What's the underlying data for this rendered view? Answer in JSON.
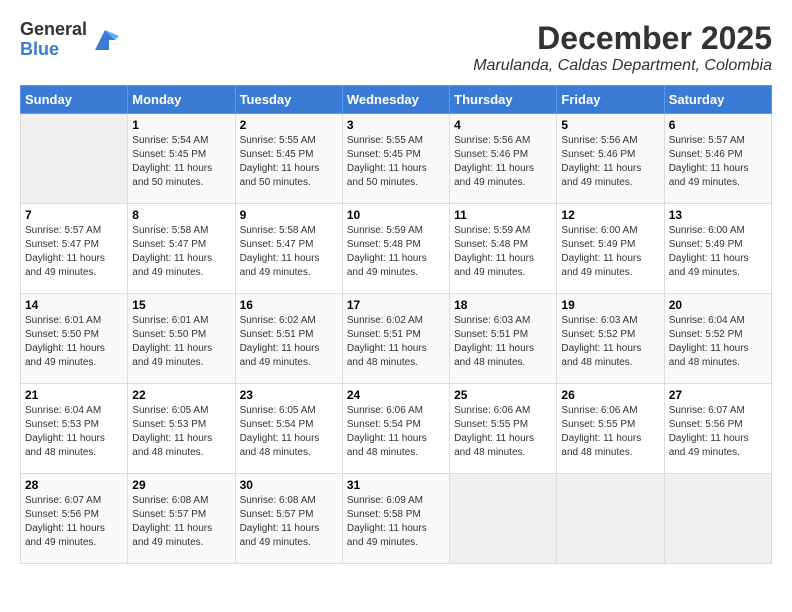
{
  "logo": {
    "general": "General",
    "blue": "Blue"
  },
  "title": "December 2025",
  "subtitle": "Marulanda, Caldas Department, Colombia",
  "days_of_week": [
    "Sunday",
    "Monday",
    "Tuesday",
    "Wednesday",
    "Thursday",
    "Friday",
    "Saturday"
  ],
  "weeks": [
    [
      {
        "day": "",
        "info": ""
      },
      {
        "day": "1",
        "info": "Sunrise: 5:54 AM\nSunset: 5:45 PM\nDaylight: 11 hours\nand 50 minutes."
      },
      {
        "day": "2",
        "info": "Sunrise: 5:55 AM\nSunset: 5:45 PM\nDaylight: 11 hours\nand 50 minutes."
      },
      {
        "day": "3",
        "info": "Sunrise: 5:55 AM\nSunset: 5:45 PM\nDaylight: 11 hours\nand 50 minutes."
      },
      {
        "day": "4",
        "info": "Sunrise: 5:56 AM\nSunset: 5:46 PM\nDaylight: 11 hours\nand 49 minutes."
      },
      {
        "day": "5",
        "info": "Sunrise: 5:56 AM\nSunset: 5:46 PM\nDaylight: 11 hours\nand 49 minutes."
      },
      {
        "day": "6",
        "info": "Sunrise: 5:57 AM\nSunset: 5:46 PM\nDaylight: 11 hours\nand 49 minutes."
      }
    ],
    [
      {
        "day": "7",
        "info": "Sunrise: 5:57 AM\nSunset: 5:47 PM\nDaylight: 11 hours\nand 49 minutes."
      },
      {
        "day": "8",
        "info": "Sunrise: 5:58 AM\nSunset: 5:47 PM\nDaylight: 11 hours\nand 49 minutes."
      },
      {
        "day": "9",
        "info": "Sunrise: 5:58 AM\nSunset: 5:47 PM\nDaylight: 11 hours\nand 49 minutes."
      },
      {
        "day": "10",
        "info": "Sunrise: 5:59 AM\nSunset: 5:48 PM\nDaylight: 11 hours\nand 49 minutes."
      },
      {
        "day": "11",
        "info": "Sunrise: 5:59 AM\nSunset: 5:48 PM\nDaylight: 11 hours\nand 49 minutes."
      },
      {
        "day": "12",
        "info": "Sunrise: 6:00 AM\nSunset: 5:49 PM\nDaylight: 11 hours\nand 49 minutes."
      },
      {
        "day": "13",
        "info": "Sunrise: 6:00 AM\nSunset: 5:49 PM\nDaylight: 11 hours\nand 49 minutes."
      }
    ],
    [
      {
        "day": "14",
        "info": "Sunrise: 6:01 AM\nSunset: 5:50 PM\nDaylight: 11 hours\nand 49 minutes."
      },
      {
        "day": "15",
        "info": "Sunrise: 6:01 AM\nSunset: 5:50 PM\nDaylight: 11 hours\nand 49 minutes."
      },
      {
        "day": "16",
        "info": "Sunrise: 6:02 AM\nSunset: 5:51 PM\nDaylight: 11 hours\nand 49 minutes."
      },
      {
        "day": "17",
        "info": "Sunrise: 6:02 AM\nSunset: 5:51 PM\nDaylight: 11 hours\nand 48 minutes."
      },
      {
        "day": "18",
        "info": "Sunrise: 6:03 AM\nSunset: 5:51 PM\nDaylight: 11 hours\nand 48 minutes."
      },
      {
        "day": "19",
        "info": "Sunrise: 6:03 AM\nSunset: 5:52 PM\nDaylight: 11 hours\nand 48 minutes."
      },
      {
        "day": "20",
        "info": "Sunrise: 6:04 AM\nSunset: 5:52 PM\nDaylight: 11 hours\nand 48 minutes."
      }
    ],
    [
      {
        "day": "21",
        "info": "Sunrise: 6:04 AM\nSunset: 5:53 PM\nDaylight: 11 hours\nand 48 minutes."
      },
      {
        "day": "22",
        "info": "Sunrise: 6:05 AM\nSunset: 5:53 PM\nDaylight: 11 hours\nand 48 minutes."
      },
      {
        "day": "23",
        "info": "Sunrise: 6:05 AM\nSunset: 5:54 PM\nDaylight: 11 hours\nand 48 minutes."
      },
      {
        "day": "24",
        "info": "Sunrise: 6:06 AM\nSunset: 5:54 PM\nDaylight: 11 hours\nand 48 minutes."
      },
      {
        "day": "25",
        "info": "Sunrise: 6:06 AM\nSunset: 5:55 PM\nDaylight: 11 hours\nand 48 minutes."
      },
      {
        "day": "26",
        "info": "Sunrise: 6:06 AM\nSunset: 5:55 PM\nDaylight: 11 hours\nand 48 minutes."
      },
      {
        "day": "27",
        "info": "Sunrise: 6:07 AM\nSunset: 5:56 PM\nDaylight: 11 hours\nand 49 minutes."
      }
    ],
    [
      {
        "day": "28",
        "info": "Sunrise: 6:07 AM\nSunset: 5:56 PM\nDaylight: 11 hours\nand 49 minutes."
      },
      {
        "day": "29",
        "info": "Sunrise: 6:08 AM\nSunset: 5:57 PM\nDaylight: 11 hours\nand 49 minutes."
      },
      {
        "day": "30",
        "info": "Sunrise: 6:08 AM\nSunset: 5:57 PM\nDaylight: 11 hours\nand 49 minutes."
      },
      {
        "day": "31",
        "info": "Sunrise: 6:09 AM\nSunset: 5:58 PM\nDaylight: 11 hours\nand 49 minutes."
      },
      {
        "day": "",
        "info": ""
      },
      {
        "day": "",
        "info": ""
      },
      {
        "day": "",
        "info": ""
      }
    ]
  ]
}
